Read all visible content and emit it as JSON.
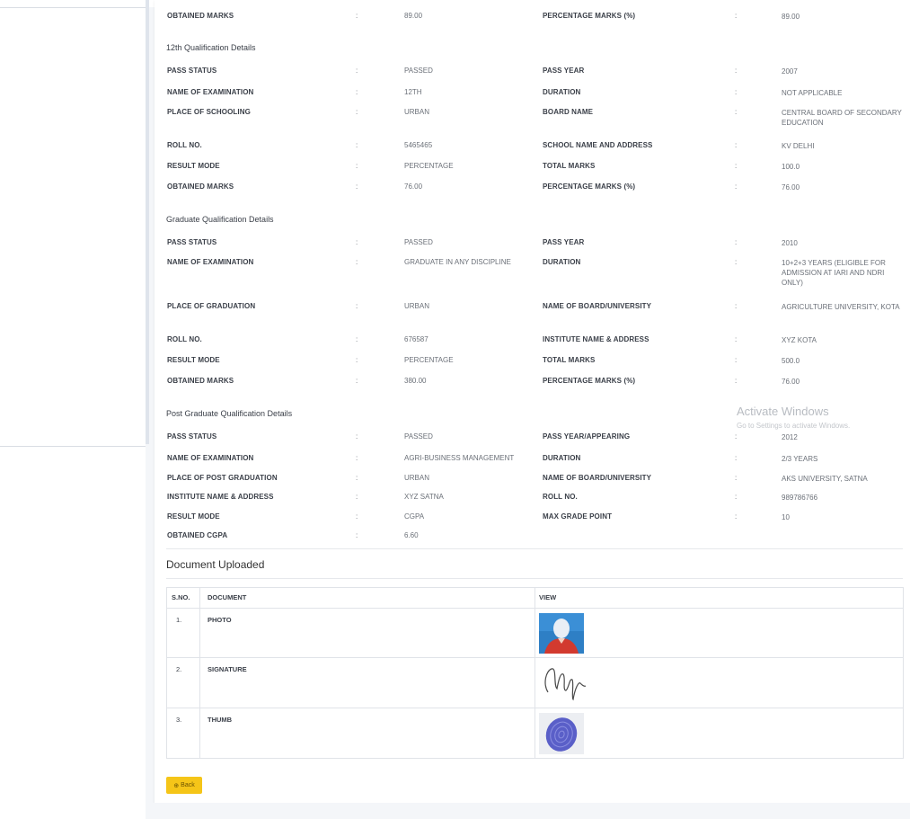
{
  "sections": {
    "top_partial": {
      "rows": [
        {
          "l1": "OBTAINED MARKS",
          "v1": "89.00",
          "l2": "PERCENTAGE MARKS (%)",
          "v2": "89.00"
        }
      ]
    },
    "twelfth": {
      "title": "12th Qualification Details",
      "rows": [
        {
          "l1": "PASS STATUS",
          "v1": "PASSED",
          "l2": "PASS YEAR",
          "v2": "2007"
        },
        {
          "l1": "NAME OF EXAMINATION",
          "v1": "12TH",
          "l2": "DURATION",
          "v2": "NOT APPLICABLE"
        },
        {
          "l1": "PLACE OF SCHOOLING",
          "v1": "URBAN",
          "l2": "BOARD NAME",
          "v2": "CENTRAL BOARD OF SECONDARY EDUCATION"
        },
        {
          "l1": "ROLL NO.",
          "v1": "5465465",
          "l2": "SCHOOL NAME AND ADDRESS",
          "v2": "KV DELHI"
        },
        {
          "l1": "RESULT MODE",
          "v1": "PERCENTAGE",
          "l2": "TOTAL MARKS",
          "v2": "100.0"
        },
        {
          "l1": "OBTAINED MARKS",
          "v1": "76.00",
          "l2": "PERCENTAGE MARKS (%)",
          "v2": "76.00"
        }
      ]
    },
    "graduate": {
      "title": "Graduate Qualification Details",
      "rows": [
        {
          "l1": "PASS STATUS",
          "v1": "PASSED",
          "l2": "PASS YEAR",
          "v2": "2010"
        },
        {
          "l1": "NAME OF EXAMINATION",
          "v1": "GRADUATE IN ANY DISCIPLINE",
          "l2": "DURATION",
          "v2": "10+2+3 YEARS (ELIGIBLE FOR ADMISSION AT IARI AND NDRI ONLY)"
        },
        {
          "l1": "PLACE OF GRADUATION",
          "v1": "URBAN",
          "l2": "NAME OF BOARD/UNIVERSITY",
          "v2": "AGRICULTURE UNIVERSITY, KOTA"
        },
        {
          "l1": "ROLL NO.",
          "v1": "676587",
          "l2": "INSTITUTE NAME & ADDRESS",
          "v2": "XYZ KOTA"
        },
        {
          "l1": "RESULT MODE",
          "v1": "PERCENTAGE",
          "l2": "TOTAL MARKS",
          "v2": "500.0"
        },
        {
          "l1": "OBTAINED MARKS",
          "v1": "380.00",
          "l2": "PERCENTAGE MARKS (%)",
          "v2": "76.00"
        }
      ]
    },
    "post_graduate": {
      "title": "Post Graduate Qualification Details",
      "rows": [
        {
          "l1": "PASS STATUS",
          "v1": "PASSED",
          "l2": "PASS YEAR/APPEARING",
          "v2": "2012"
        },
        {
          "l1": "NAME OF EXAMINATION",
          "v1": "AGRI-BUSINESS MANAGEMENT",
          "l2": "DURATION",
          "v2": "2/3 YEARS"
        },
        {
          "l1": "PLACE OF POST GRADUATION",
          "v1": "URBAN",
          "l2": "NAME OF BOARD/UNIVERSITY",
          "v2": "AKS UNIVERSITY, SATNA"
        },
        {
          "l1": "INSTITUTE NAME & ADDRESS",
          "v1": "XYZ SATNA",
          "l2": "ROLL NO.",
          "v2": "989786766"
        },
        {
          "l1": "RESULT MODE",
          "v1": "CGPA",
          "l2": "MAX GRADE POINT",
          "v2": "10"
        },
        {
          "l1": "OBTAINED CGPA",
          "v1": "6.60",
          "l2": "",
          "v2": ""
        }
      ]
    }
  },
  "colon": ":",
  "documents": {
    "heading": "Document Uploaded",
    "headers": {
      "sno": "S.NO.",
      "document": "DOCUMENT",
      "view": "VIEW"
    },
    "rows": [
      {
        "sno": "1.",
        "document": "PHOTO",
        "view_icon": "photo-thumbnail"
      },
      {
        "sno": "2.",
        "document": "SIGNATURE",
        "view_icon": "signature-thumbnail"
      },
      {
        "sno": "3.",
        "document": "THUMB",
        "view_icon": "thumbprint-thumbnail"
      }
    ]
  },
  "back_button": {
    "label": "Back",
    "icon": "back-arrow-icon",
    "color": "#f5c518"
  },
  "watermark": {
    "title": "Activate Windows",
    "subtitle": "Go to Settings to activate Windows."
  }
}
